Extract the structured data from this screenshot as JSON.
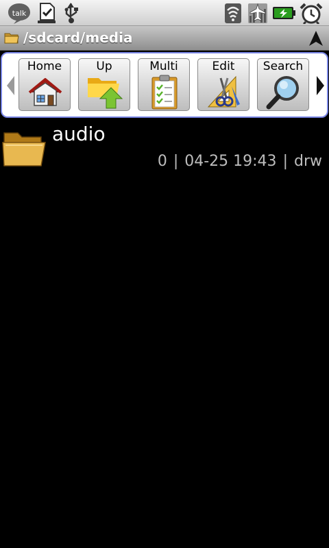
{
  "status_bar": {
    "icons": [
      "talk-icon",
      "download-done-icon",
      "usb-icon",
      "wifi-icon",
      "airplane-mode-icon",
      "battery-charging-icon",
      "alarm-clock-icon"
    ],
    "talk_label": "talk"
  },
  "path_bar": {
    "path": "/sdcard/media",
    "folder_icon": "folder-icon",
    "up_icon": "arrow-up-icon"
  },
  "toolbar": {
    "left_arrow_icon": "chevron-left-icon",
    "right_arrow_icon": "chevron-right-icon",
    "buttons": [
      {
        "label": "Home",
        "icon": "house-icon"
      },
      {
        "label": "Up",
        "icon": "folder-up-icon"
      },
      {
        "label": "Multi",
        "icon": "clipboard-checklist-icon"
      },
      {
        "label": "Edit",
        "icon": "edit-tools-icon"
      },
      {
        "label": "Search",
        "icon": "magnifier-icon"
      }
    ]
  },
  "files": [
    {
      "name": "audio",
      "size": "0",
      "date": "04-25 19:43",
      "perms": "drw",
      "icon": "folder-icon"
    }
  ],
  "colors": {
    "toolbar_border": "#7a86e6",
    "folder": "#e8b850",
    "battery": "#2a9d1e",
    "meta_text": "#bdbdbd"
  }
}
